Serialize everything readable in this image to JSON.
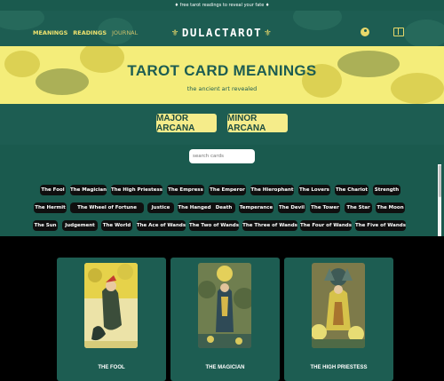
{
  "promo": {
    "text": "♦ free tarot readings to reveal your fate ♦"
  },
  "nav": {
    "links": [
      "MEANINGS",
      "READINGS",
      "JOURNAL"
    ],
    "brand": "DULACTAROT",
    "user_icon": "user-icon",
    "book_icon": "book-icon"
  },
  "hero": {
    "title": "TAROT CARD MEANINGS",
    "subtitle": "the ancient art revealed"
  },
  "arcana": {
    "major": "MAJOR ARCANA",
    "minor": "MINOR ARCANA"
  },
  "search": {
    "placeholder": "search cards"
  },
  "chips": [
    "The Fool",
    "The Magician",
    "The High Priestess",
    "The Empress",
    "The Emperor",
    "The Hierophant",
    "The Lovers",
    "The Chariot",
    "Strength",
    "The Hermit",
    "The Wheel of Fortune",
    "Justice",
    "The Hanged Man",
    "Death",
    "Temperance",
    "The Devil",
    "The Tower",
    "The Star",
    "The Moon",
    "The Sun",
    "Judgement",
    "The World",
    "The Ace of Wands",
    "The Two of Wands",
    "The Three of Wands",
    "The Four of Wands",
    "The Five of Wands"
  ],
  "cards": [
    {
      "title": "THE FOOL"
    },
    {
      "title": "THE MAGICIAN"
    },
    {
      "title": "THE HIGH PRIESTESS"
    }
  ],
  "colors": {
    "primary": "#1d5d52",
    "accent": "#f4ed7a",
    "chip": "#0f0f0f"
  }
}
